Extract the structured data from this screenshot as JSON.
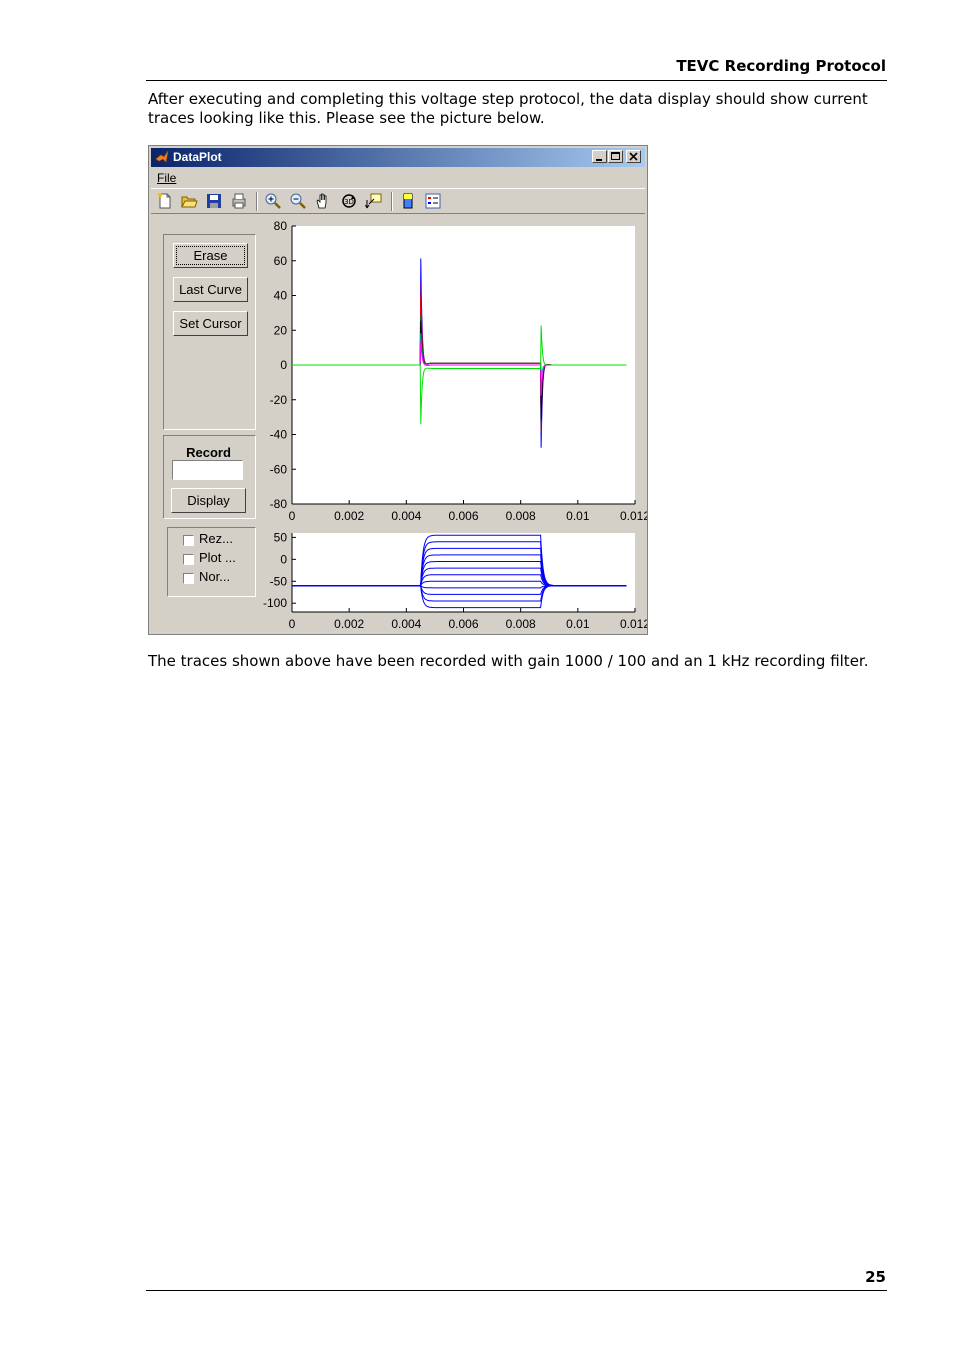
{
  "header": {
    "title": "TEVC Recording Protocol"
  },
  "intro": "After executing and completing this voltage step protocol, the data display should show current traces looking like this. Please see the picture below.",
  "caption": "The traces shown above have been recorded with gain 1000 / 100 and an 1 kHz recording filter.",
  "page_number": "25",
  "window": {
    "title": "DataPlot",
    "menu": {
      "file": "File"
    },
    "toolbar": [
      "new-file-icon",
      "open-folder-icon",
      "save-icon",
      "print-icon",
      "zoom-in-icon",
      "zoom-out-icon",
      "pan-hand-icon",
      "rotate-3d-icon",
      "data-cursor-icon",
      "colorbar-icon",
      "legend-icon"
    ],
    "buttons": {
      "erase": "Erase",
      "last_curve": "Last Curve",
      "set_cursor": "Set Cursor",
      "display": "Display"
    },
    "record": {
      "label": "Record",
      "value": ""
    },
    "checkboxes": [
      "Rez...",
      "Plot ...",
      "Nor..."
    ]
  },
  "chart_data": [
    {
      "type": "line",
      "title": "",
      "xlabel": "",
      "ylabel": "",
      "xlim": [
        0,
        0.012
      ],
      "ylim": [
        -80,
        80
      ],
      "x_ticks": [
        "0",
        "0.002",
        "0.004",
        "0.006",
        "0.008",
        "0.01",
        "0.012"
      ],
      "y_ticks": [
        "80",
        "60",
        "40",
        "20",
        "0",
        "-20",
        "-40",
        "-60",
        "-80"
      ],
      "x_range": [
        0,
        0.0117
      ],
      "on_time": 0.0045,
      "off_time": 0.0087,
      "series": [
        {
          "color": "#0000ff",
          "on_peak": 66,
          "off_peak": -67,
          "plateau": 1
        },
        {
          "color": "#800080",
          "on_peak": 50,
          "off_peak": -55,
          "plateau": 1
        },
        {
          "color": "#ff0000",
          "on_peak": 42,
          "off_peak": -40,
          "plateau": 1
        },
        {
          "color": "#008000",
          "on_peak": 30,
          "off_peak": -35,
          "plateau": 1
        },
        {
          "color": "#000000",
          "on_peak": 28,
          "off_peak": -45,
          "plateau": 0
        },
        {
          "color": "#00c0c0",
          "on_peak": 20,
          "off_peak": -10,
          "plateau": 0
        },
        {
          "color": "#ff00ff",
          "on_peak": 15,
          "off_peak": -25,
          "plateau": 0
        },
        {
          "color": "#00e000",
          "on_peak": -35,
          "off_peak": 32,
          "plateau": -2
        }
      ]
    },
    {
      "type": "line",
      "title": "",
      "xlabel": "",
      "ylabel": "",
      "xlim": [
        0,
        0.012
      ],
      "ylim": [
        -120,
        60
      ],
      "x_ticks": [
        "0",
        "0.002",
        "0.004",
        "0.006",
        "0.008",
        "0.01",
        "0.012"
      ],
      "y_ticks": [
        "50",
        "0",
        "-50",
        "-100"
      ],
      "x_range": [
        0,
        0.0117
      ],
      "on_time": 0.0045,
      "off_time": 0.0087,
      "holding": -60,
      "steps": [
        55,
        40,
        25,
        10,
        -5,
        -20,
        -35,
        -50,
        -65,
        -80,
        -95,
        -110
      ],
      "color": "#0000ff"
    }
  ]
}
